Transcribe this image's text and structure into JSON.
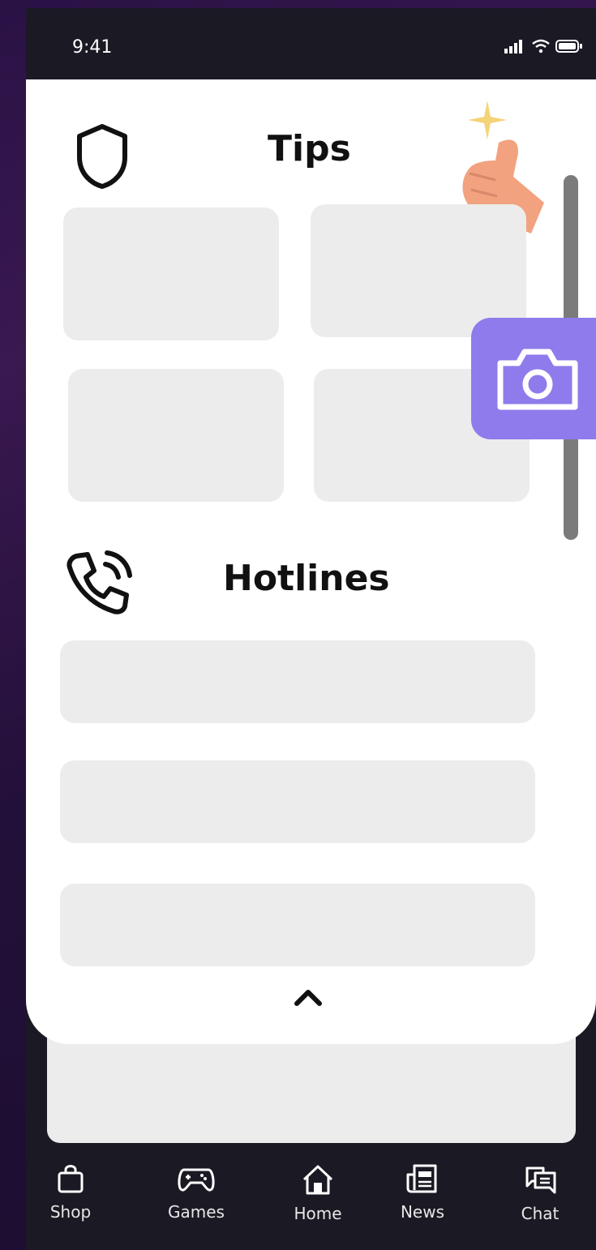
{
  "status_bar": {
    "time": "9:41"
  },
  "tips": {
    "title": "Tips"
  },
  "hotlines": {
    "title": "Hotlines"
  },
  "tabs": [
    {
      "label": "Shop",
      "icon": "shopping-bag-icon"
    },
    {
      "label": "Games",
      "icon": "gamepad-icon"
    },
    {
      "label": "Home",
      "icon": "home-icon"
    },
    {
      "label": "News",
      "icon": "newspaper-icon"
    },
    {
      "label": "Chat",
      "icon": "chat-bubbles-icon"
    }
  ],
  "colors": {
    "accent": "#8f7bec",
    "tile": "#ececec",
    "dark": "#1b1a24"
  }
}
